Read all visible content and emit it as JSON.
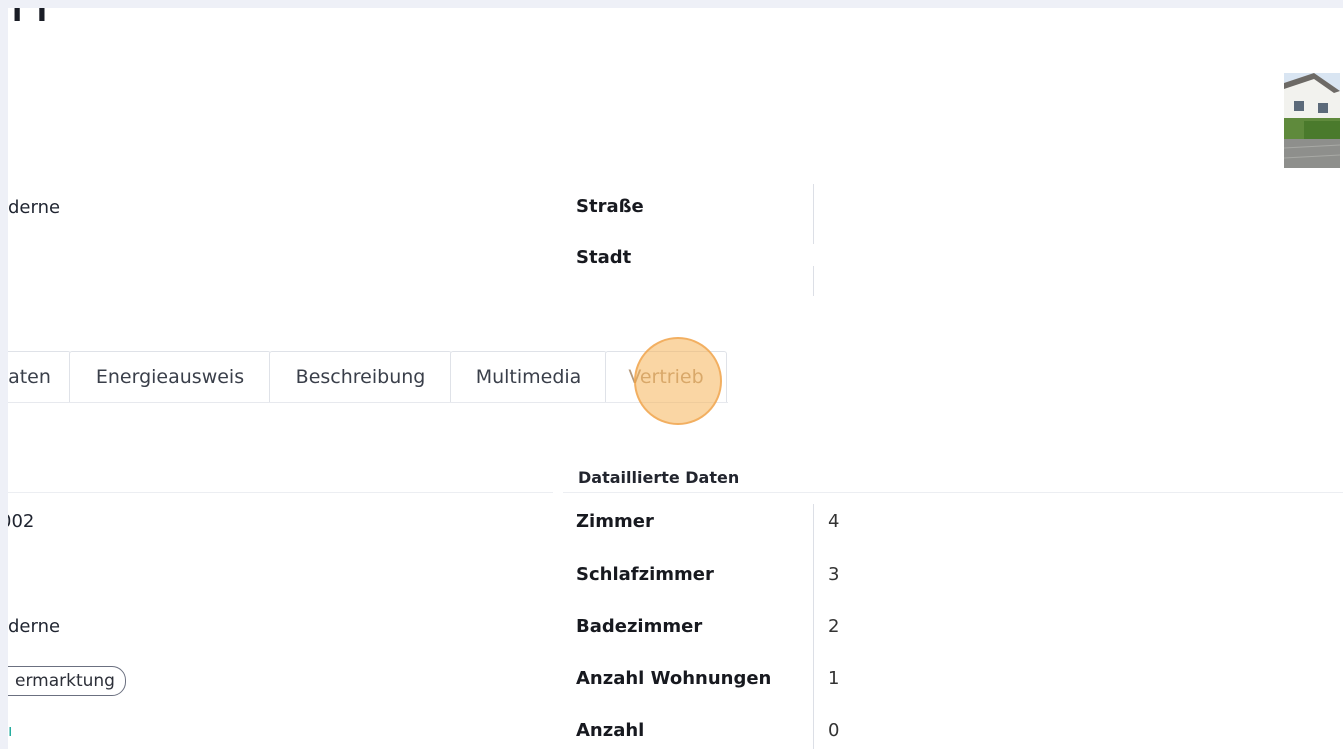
{
  "page": {
    "title_fragment": "ı ı"
  },
  "top_left": {
    "fragment_1": "derne",
    "fragment_2": "002",
    "fragment_3": "derne",
    "badge": "ermarktung",
    "teal_mark": "ı"
  },
  "address": {
    "street_label": "Straße",
    "city_label": "Stadt",
    "street_value": "",
    "city_value": ""
  },
  "tabs": [
    {
      "label": "aten"
    },
    {
      "label": "Energieausweis"
    },
    {
      "label": "Beschreibung"
    },
    {
      "label": "Multimedia"
    },
    {
      "label": "Vertrieb"
    }
  ],
  "details": {
    "heading": "Dataillierte Daten",
    "rows": [
      {
        "label": "Zimmer",
        "value": "4"
      },
      {
        "label": "Schlafzimmer",
        "value": "3"
      },
      {
        "label": "Badezimmer",
        "value": "2"
      },
      {
        "label": "Anzahl Wohnungen",
        "value": "1"
      },
      {
        "label": "Anzahl",
        "value": "0"
      }
    ]
  },
  "colors": {
    "background": "#eef0f7",
    "panel": "#ffffff",
    "cursor_highlight": "#f6b45a",
    "teal": "#1aa99a"
  },
  "icons": {
    "property_thumbnail": "house-photo-thumbnail"
  }
}
